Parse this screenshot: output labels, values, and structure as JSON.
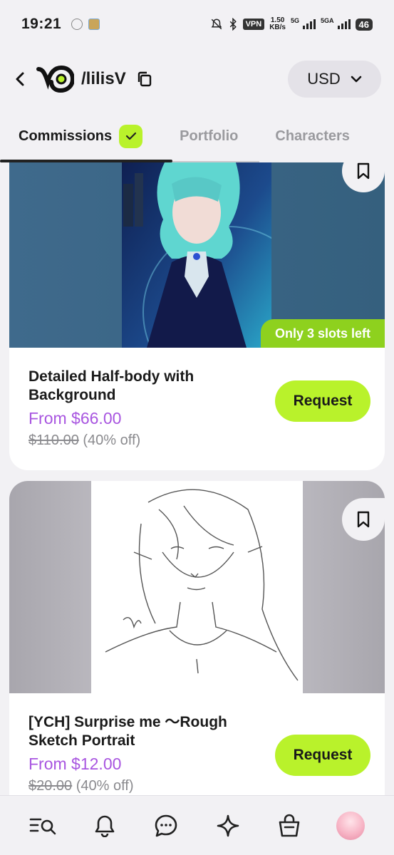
{
  "status_bar": {
    "time": "19:21",
    "vpn": "VPN",
    "net_speed_value": "1.50",
    "net_speed_unit": "KB/s",
    "net1": "5G",
    "net2": "5GA",
    "battery": "46"
  },
  "header": {
    "profile_name": "/lilisV",
    "currency": "USD"
  },
  "tabs": [
    {
      "label": "Commissions",
      "active": true
    },
    {
      "label": "Portfolio",
      "active": false
    },
    {
      "label": "Characters",
      "active": false
    }
  ],
  "cards": [
    {
      "title": "Detailed Half-body with Background",
      "price": "From $66.00",
      "old_price": "$110.00",
      "discount": "(40% off)",
      "badge": "Only 3 slots left",
      "button": "Request"
    },
    {
      "title": "[YCH] Surprise me ～Rough Sketch Portrait",
      "price": "From $12.00",
      "old_price": "$20.00",
      "discount": "(40% off)",
      "button": "Request"
    }
  ],
  "bottom_nav": [
    "search-list-icon",
    "bell-icon",
    "chat-icon",
    "sparkle-icon",
    "shopping-bag-icon",
    "avatar"
  ],
  "colors": {
    "accent_green": "#b9f22b",
    "badge_green": "#8ed11e",
    "price_purple": "#a855e0"
  }
}
